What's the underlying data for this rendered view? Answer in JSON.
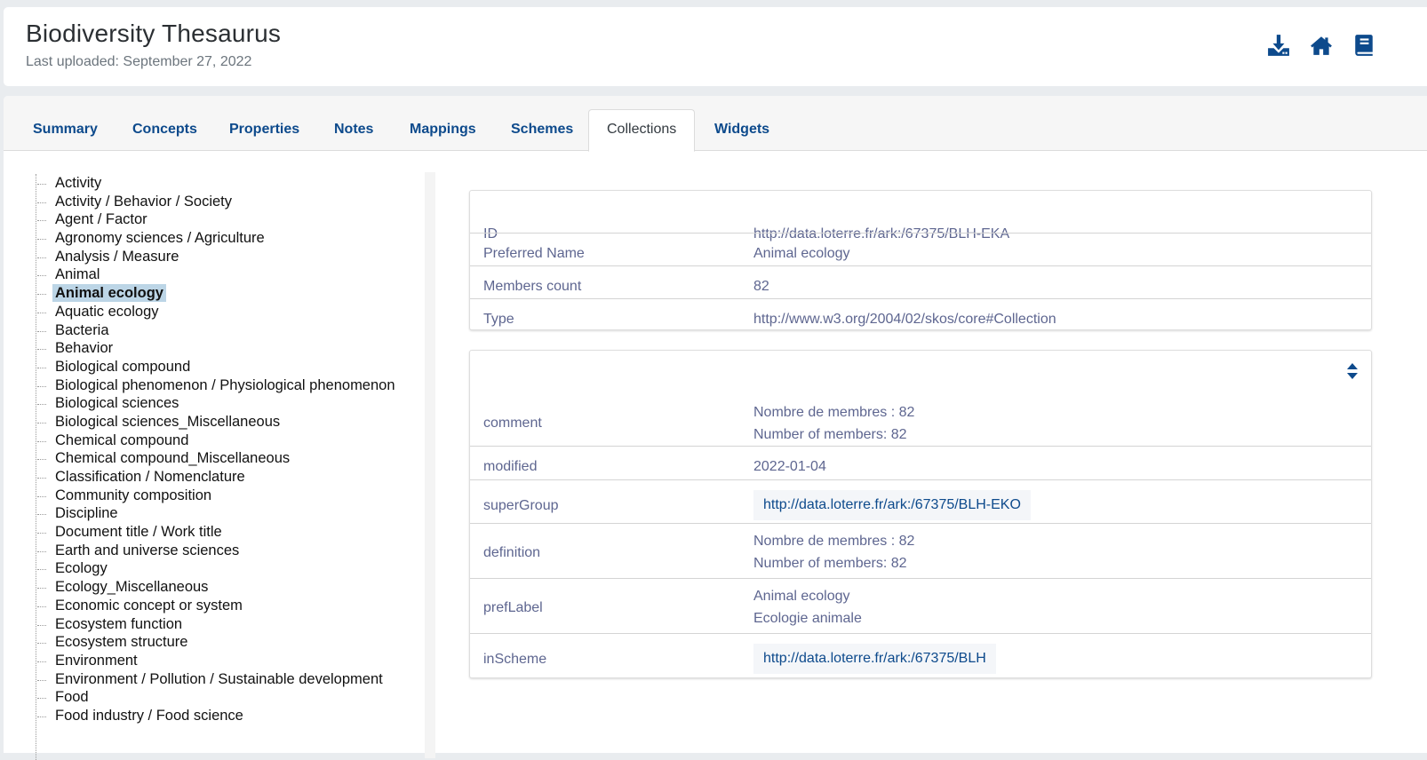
{
  "header": {
    "title": "Biodiversity Thesaurus",
    "subtitle": "Last uploaded: September 27, 2022",
    "icons": [
      "download-icon",
      "home-icon",
      "book-icon"
    ]
  },
  "tabs": [
    {
      "label": "Summary",
      "active": false
    },
    {
      "label": "Concepts",
      "active": false
    },
    {
      "label": "Properties",
      "active": false
    },
    {
      "label": "Notes",
      "active": false
    },
    {
      "label": "Mappings",
      "active": false
    },
    {
      "label": "Schemes",
      "active": false
    },
    {
      "label": "Collections",
      "active": true
    },
    {
      "label": "Widgets",
      "active": false
    }
  ],
  "tree": {
    "selected": "Animal ecology",
    "items": [
      "Activity",
      "Activity / Behavior / Society",
      "Agent / Factor",
      "Agronomy sciences / Agriculture",
      "Analysis / Measure",
      "Animal",
      "Animal ecology",
      "Aquatic ecology",
      "Bacteria",
      "Behavior",
      "Biological compound",
      "Biological phenomenon / Physiological phenomenon",
      "Biological sciences",
      "Biological sciences_Miscellaneous",
      "Chemical compound",
      "Chemical compound_Miscellaneous",
      "Classification / Nomenclature",
      "Community composition",
      "Discipline",
      "Document title / Work title",
      "Earth and universe sciences",
      "Ecology",
      "Ecology_Miscellaneous",
      "Economic concept or system",
      "Ecosystem function",
      "Ecosystem structure",
      "Environment",
      "Environment / Pollution / Sustainable development",
      "Food",
      "Food industry / Food science"
    ]
  },
  "summary": {
    "id_label": "ID",
    "id_value": "http://data.loterre.fr/ark:/67375/BLH-EKA",
    "pref_label": "Preferred Name",
    "pref_value": "Animal ecology",
    "members_label": "Members count",
    "members_value": "82",
    "type_label": "Type",
    "type_value": "http://www.w3.org/2004/02/skos/core#Collection"
  },
  "properties": {
    "sort_icon": "sort-icon",
    "comment": {
      "key": "comment",
      "values": [
        "Nombre de membres : 82",
        "Number of members: 82"
      ]
    },
    "modified": {
      "key": "modified",
      "value": "2022-01-04"
    },
    "superGroup": {
      "key": "superGroup",
      "link": "http://data.loterre.fr/ark:/67375/BLH-EKO"
    },
    "definition": {
      "key": "definition",
      "values": [
        "Nombre de membres : 82",
        "Number of members: 82"
      ]
    },
    "prefLabel": {
      "key": "prefLabel",
      "values": [
        "Animal ecology",
        "Ecologie animale"
      ]
    },
    "inScheme": {
      "key": "inScheme",
      "link": "http://data.loterre.fr/ark:/67375/BLH"
    }
  },
  "colors": {
    "accent": "#0d4a8c",
    "selected_bg": "#bcd5e6",
    "value_text": "#5e6690",
    "page_bg": "#e9ecef"
  }
}
